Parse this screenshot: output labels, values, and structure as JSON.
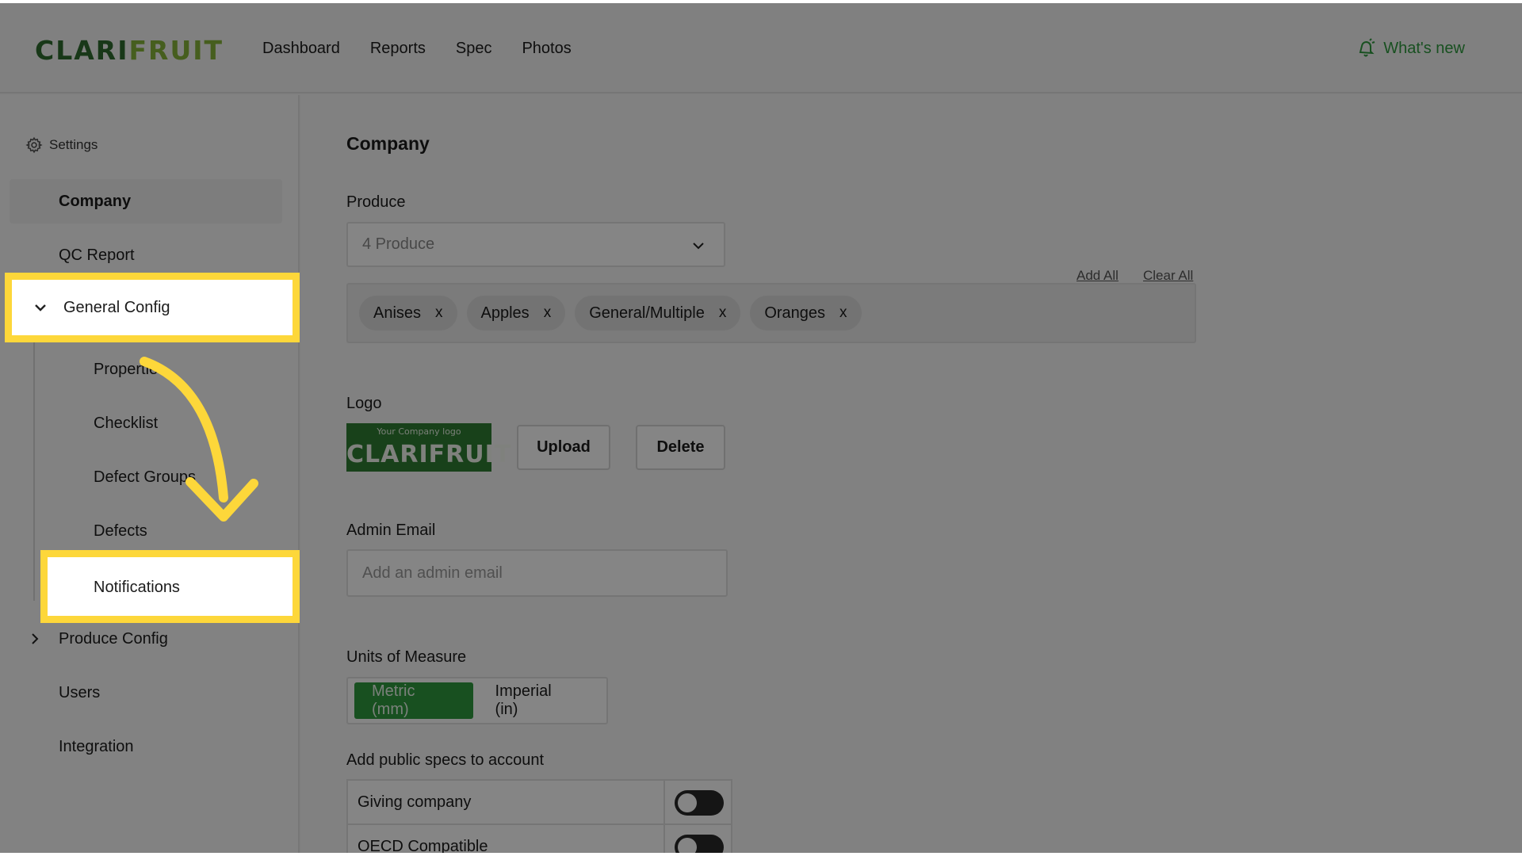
{
  "brand": {
    "part1": "CLARI",
    "part2": "FRUIT",
    "color_dark": "#2f6b2f",
    "color_light": "#86b43a"
  },
  "nav": {
    "items": [
      "Dashboard",
      "Reports",
      "Spec",
      "Photos"
    ]
  },
  "whats_new": {
    "label": "What's new",
    "icon": "bell-icon",
    "color": "#2e9a3f"
  },
  "sidebar": {
    "header": "Settings",
    "items": {
      "company": "Company",
      "qc_report": "QC Report",
      "general_config": "General Config",
      "produce_config": "Produce Config",
      "users": "Users",
      "integration": "Integration"
    },
    "sub_items": {
      "properties": "Properties",
      "checklist": "Checklist",
      "defect_groups": "Defect Groups",
      "defects": "Defects",
      "notifications": "Notifications"
    }
  },
  "main": {
    "title": "Company",
    "produce": {
      "label": "Produce",
      "select_value": "4 Produce",
      "add_all": "Add All",
      "clear_all": "Clear All",
      "tags": [
        "Anises",
        "Apples",
        "General/Multiple",
        "Oranges"
      ],
      "remove_glyph": "x"
    },
    "logo": {
      "label": "Logo",
      "caption": "Your Company logo",
      "wordmark": "CLARIFRUIT",
      "upload": "Upload",
      "delete": "Delete"
    },
    "admin_email": {
      "label": "Admin Email",
      "placeholder": "Add an admin email"
    },
    "units": {
      "label": "Units of Measure",
      "metric": "Metric (mm)",
      "imperial": "Imperial (in)",
      "selected": "Metric (mm)",
      "accent": "#2e9a3f"
    },
    "public_specs": {
      "label": "Add public specs to account",
      "rows": [
        {
          "name": "Giving company",
          "enabled": false
        },
        {
          "name": "OECD Compatible",
          "enabled": false
        }
      ]
    }
  },
  "highlight_color": "#fdd73a"
}
